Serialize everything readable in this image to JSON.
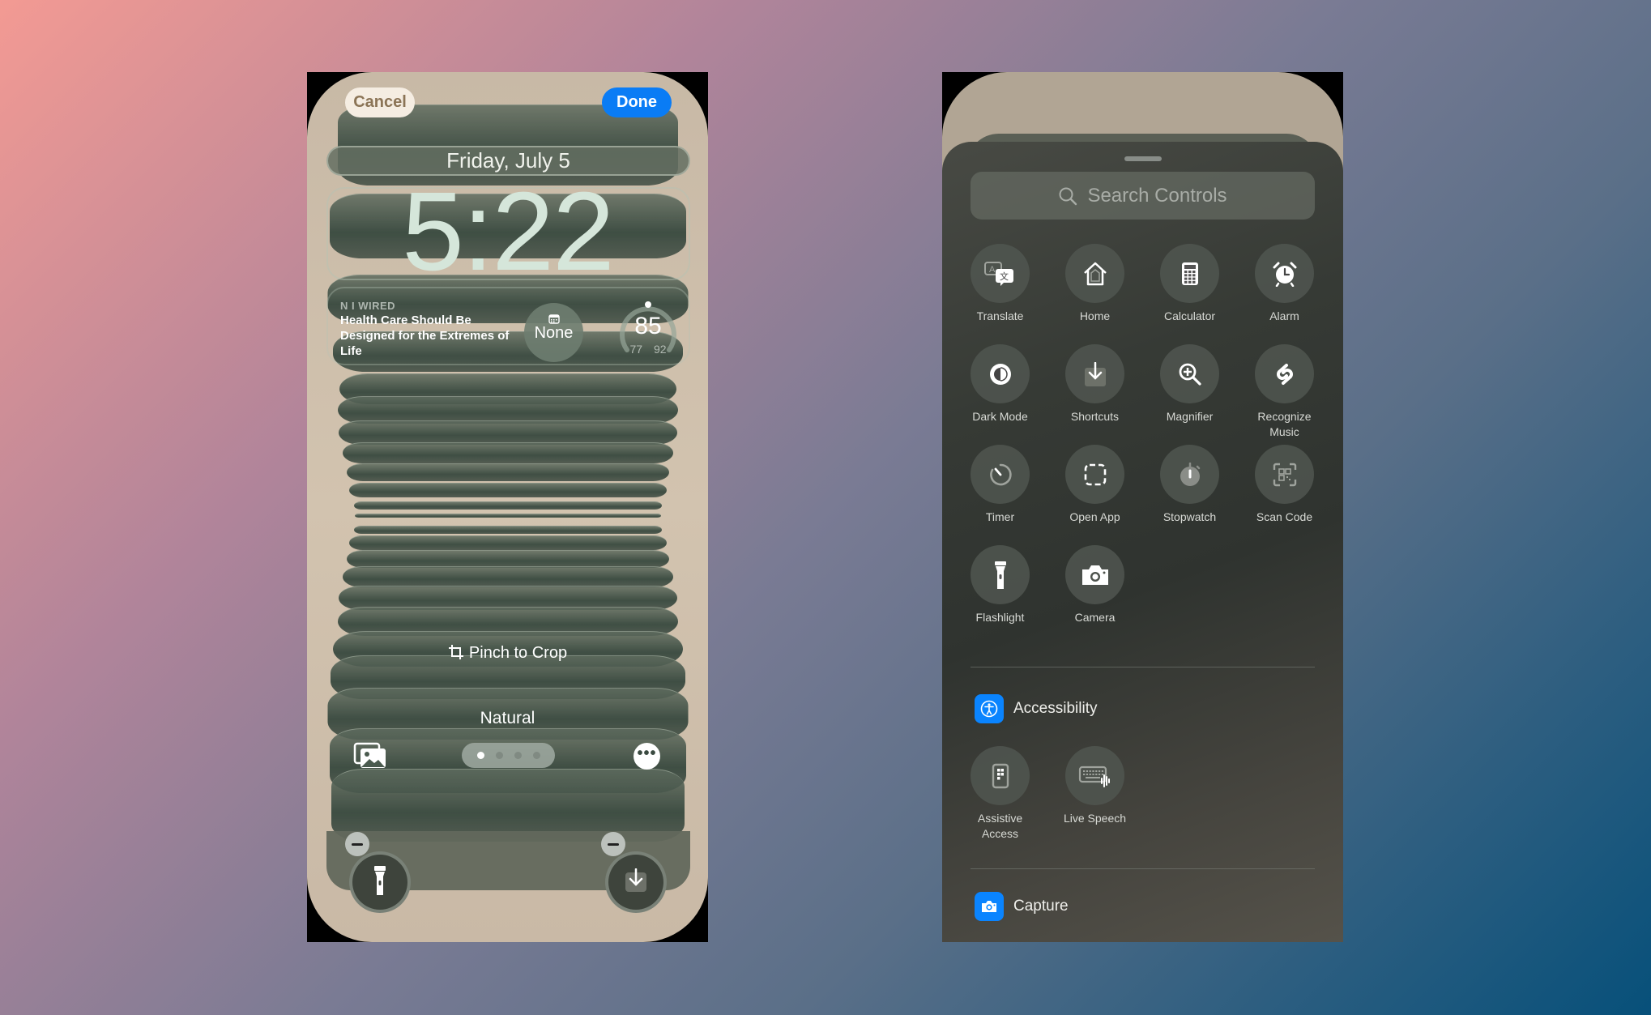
{
  "left_screen": {
    "cancel_label": "Cancel",
    "done_label": "Done",
    "date": "Friday, July 5",
    "time": "5:22",
    "news_widget": {
      "source": "N I WIRED",
      "headline": "Health Care Should Be Designed for the Extremes of Life"
    },
    "calendar_widget": {
      "icon": "calendar-icon",
      "value": "None"
    },
    "weather_widget": {
      "temperature": "85",
      "low": "77",
      "high": "92",
      "gauge_fraction": 0.5
    },
    "crop_hint": "Pinch to Crop",
    "filter_name": "Natural",
    "page_dots": {
      "count": 4,
      "active_index": 0
    },
    "lock_controls": [
      {
        "name": "Flashlight",
        "icon": "flashlight-icon"
      },
      {
        "name": "Shortcuts",
        "icon": "shortcuts-icon"
      }
    ]
  },
  "right_screen": {
    "search_placeholder": "Search Controls",
    "controls": [
      {
        "label": "Translate",
        "icon": "translate-icon"
      },
      {
        "label": "Home",
        "icon": "home-icon"
      },
      {
        "label": "Calculator",
        "icon": "calculator-icon"
      },
      {
        "label": "Alarm",
        "icon": "alarm-icon"
      },
      {
        "label": "Dark Mode",
        "icon": "dark-mode-icon"
      },
      {
        "label": "Shortcuts",
        "icon": "shortcuts-icon"
      },
      {
        "label": "Magnifier",
        "icon": "magnifier-icon"
      },
      {
        "label": "Recognize Music",
        "icon": "shazam-icon"
      },
      {
        "label": "Timer",
        "icon": "timer-icon"
      },
      {
        "label": "Open App",
        "icon": "open-app-icon"
      },
      {
        "label": "Stopwatch",
        "icon": "stopwatch-icon"
      },
      {
        "label": "Scan Code",
        "icon": "qr-code-icon"
      },
      {
        "label": "Flashlight",
        "icon": "flashlight-icon"
      },
      {
        "label": "Camera",
        "icon": "camera-icon"
      }
    ],
    "sections": [
      {
        "title": "Accessibility",
        "icon": "accessibility-icon",
        "controls": [
          {
            "label": "Assistive Access",
            "icon": "assistive-access-icon"
          },
          {
            "label": "Live Speech",
            "icon": "keyboard-waveform-icon"
          }
        ]
      },
      {
        "title": "Capture",
        "icon": "camera-icon",
        "controls": []
      }
    ]
  },
  "colors": {
    "accent_blue": "#0a7cf5",
    "section_icon_blue": "#0a84ff",
    "wallpaper_beige": "#d2c3af",
    "wallpaper_green": "#374a3e"
  }
}
